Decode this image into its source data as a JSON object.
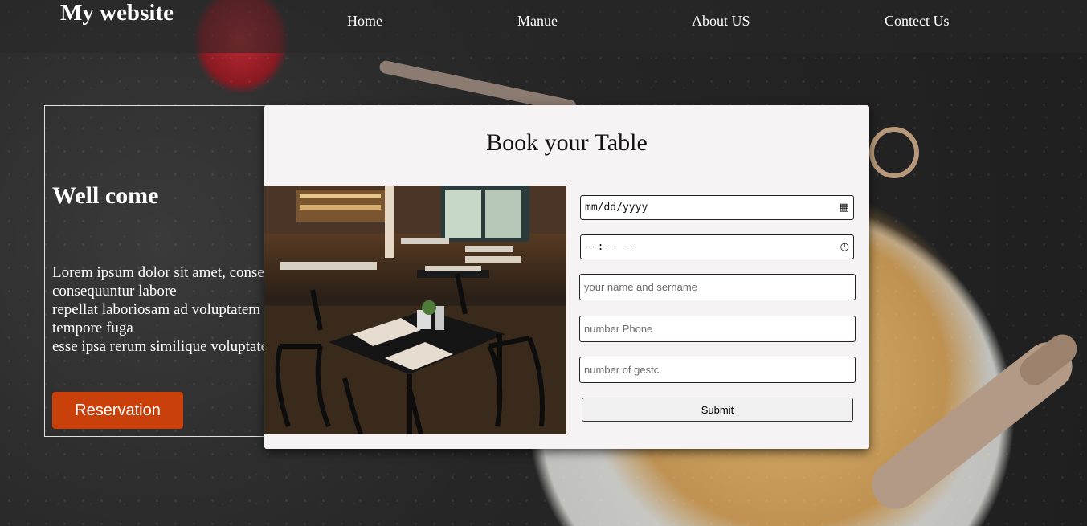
{
  "header": {
    "brand": "My website",
    "nav": [
      {
        "label": "Home"
      },
      {
        "label": "Manue"
      },
      {
        "label": "About US"
      },
      {
        "label": "Contect Us"
      }
    ]
  },
  "hero": {
    "title": "Well come",
    "lines": [
      "Lorem ipsum dolor sit amet, consectetur adipisicing elit. Quasi",
      "consequuntur labore",
      "repellat laboriosam ad voluptatem",
      "tempore fuga",
      "esse ipsa rerum similique voluptate"
    ],
    "button_label": "Reservation"
  },
  "booking": {
    "title": "Book your Table",
    "date_value": "mm/dd/yyyy",
    "time_value": "--:-- --",
    "name_placeholder": "your name and sername",
    "phone_placeholder": "number Phone",
    "guests_placeholder": "number of gestc",
    "submit_label": "Submit",
    "date_icon": "calendar-icon",
    "time_icon": "clock-icon"
  },
  "colors": {
    "reservation_button": "#c9400b",
    "card_background": "#f6f3f4"
  }
}
